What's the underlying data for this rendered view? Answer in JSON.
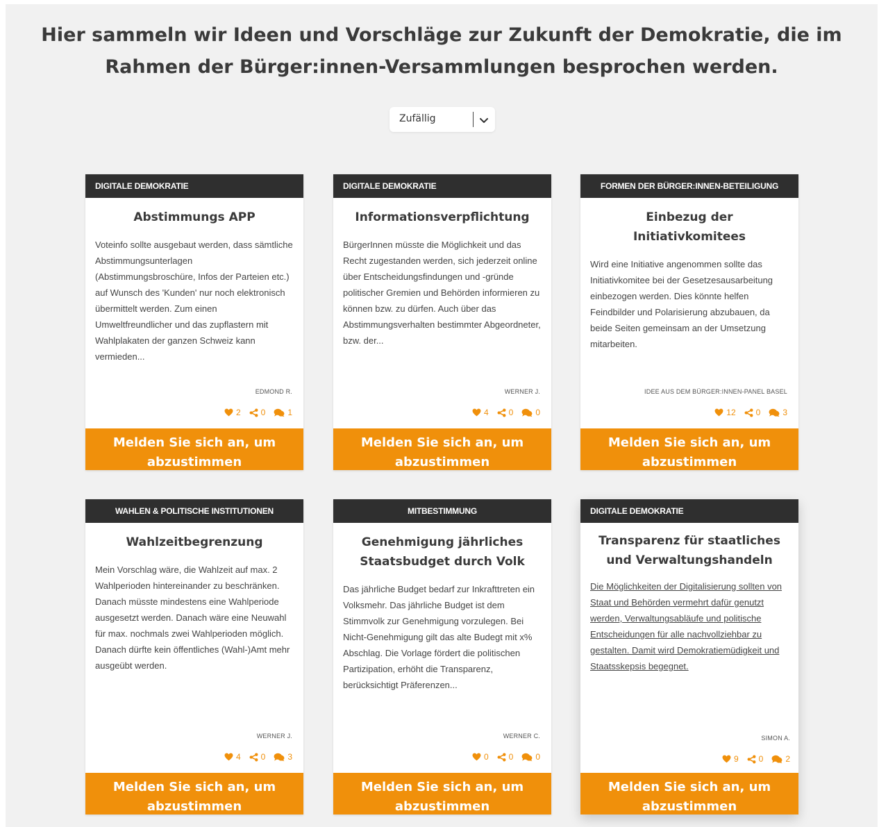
{
  "heading": "Hier sammeln wir Ideen und Vorschläge zur Zukunft der Demokratie, die im Rahmen der Bürger:innen-Versammlungen besprochen werden.",
  "sort": {
    "selected": "Zufällig"
  },
  "vote_label": "Melden Sie sich an, um abzustimmen",
  "colors": {
    "accent": "#f0900b",
    "category_bg": "#2f2f2f"
  },
  "cards": [
    {
      "category": "DIGITALE DEMOKRATIE",
      "title": "Abstimmungs APP",
      "description": "Voteinfo sollte ausgebaut werden, dass sämtliche Abstimmungsunterlagen (Abstimmungsbroschüre, Infos der Parteien etc.) auf Wunsch des 'Kunden' nur noch elektronisch übermittelt werden. Zum einen Umweltfreundlicher und das zupflastern mit Wahlplakaten der ganzen Schweiz kann vermieden...",
      "author": "EDMOND R.",
      "likes": "2",
      "shares": "0",
      "comments": "1"
    },
    {
      "category": "DIGITALE DEMOKRATIE",
      "title": "Informationsverpflichtung",
      "description": "BürgerInnen müsste die Möglichkeit und das Recht zugestanden werden, sich jederzeit online über Entscheidungsfindungen und -gründe politischer Gremien und Behörden informieren zu können bzw. zu dürfen. Auch über das Abstimmungsverhalten bestimmter Abgeordneter, bzw. der...",
      "author": "WERNER J.",
      "likes": "4",
      "shares": "0",
      "comments": "0"
    },
    {
      "category": "FORMEN DER BÜRGER:INNEN-BETEILIGUNG",
      "title": "Einbezug der Initiativkomitees",
      "description": "Wird eine Initiative angenommen sollte das Initiativkomitee bei der Gesetzesausarbeitung einbezogen werden. Dies könnte helfen Feindbilder und Polarisierung abzubauen, da beide Seiten gemeinsam an der Umsetzung mitarbeiten.",
      "author": "IDEE AUS DEM BÜRGER:INNEN-PANEL BASEL",
      "likes": "12",
      "shares": "0",
      "comments": "3"
    },
    {
      "category": "WAHLEN & POLITISCHE INSTITUTIONEN",
      "title": "Wahlzeitbegrenzung",
      "description": "Mein Vorschlag wäre, die Wahlzeit auf max. 2 Wahlperioden hintereinander zu beschränken. Danach müsste mindestens eine Wahlperiode ausgesetzt werden. Danach wäre eine Neuwahl für max. nochmals zwei Wahlperioden möglich. Danach dürfte kein öffentliches (Wahl-)Amt mehr ausgeübt werden.",
      "author": "WERNER J.",
      "likes": "4",
      "shares": "0",
      "comments": "3"
    },
    {
      "category": "MITBESTIMMUNG",
      "title": "Genehmigung jährliches Staatsbudget durch Volk",
      "description": "Das jährliche Budget bedarf zur Inkrafttreten ein Volksmehr. Das jährliche Budget ist dem Stimmvolk zur Genehmigung vorzulegen. Bei Nicht-Genehmigung gilt das alte Budegt mit x% Abschlag. Die Vorlage fördert die politischen Partizipation, erhöht die Transparenz, berücksichtigt Präferenzen...",
      "author": "WERNER C.",
      "likes": "0",
      "shares": "0",
      "comments": "0"
    },
    {
      "category": "DIGITALE DEMOKRATIE",
      "title": "Transparenz für staatliches und Verwaltungshandeln",
      "description": "Die Möglichkeiten der Digitalisierung sollten von Staat und Behörden vermehrt dafür genutzt werden, Verwaltungsabläufe und politische Entscheidungen für alle nachvollziehbar zu gestalten. Damit wird Demokratiemüdigkeit und Staatsskepsis begegnet.",
      "author": "SIMON A.",
      "likes": "9",
      "shares": "0",
      "comments": "2"
    }
  ]
}
